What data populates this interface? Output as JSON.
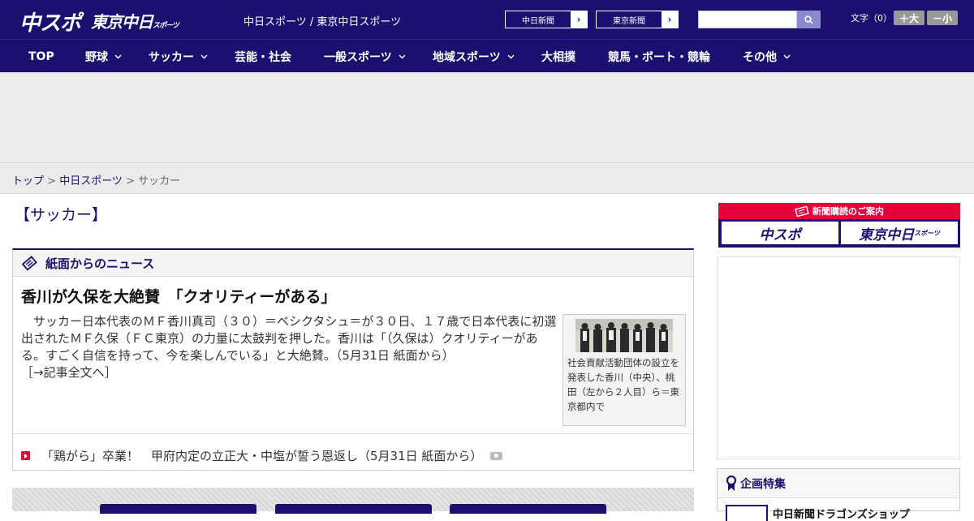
{
  "header": {
    "logo_chuspo": "中スポ",
    "logo_tokyo": "東京中日",
    "logo_tokyo_suffix": "スポーツ",
    "site_title": "中日スポーツ / 東京中日スポーツ",
    "paper_links": [
      {
        "label": "中日新聞"
      },
      {
        "label": "東京新聞"
      }
    ],
    "search_placeholder": "",
    "font_size_label": "文字（0）",
    "font_bigger": "＋大",
    "font_smaller": "－小"
  },
  "nav": {
    "items": [
      {
        "label": "TOP",
        "has_menu": false
      },
      {
        "label": "野球",
        "has_menu": true
      },
      {
        "label": "サッカー",
        "has_menu": true
      },
      {
        "label": "芸能・社会",
        "has_menu": false
      },
      {
        "label": "一般スポーツ",
        "has_menu": true
      },
      {
        "label": "地域スポーツ",
        "has_menu": true
      },
      {
        "label": "大相撲",
        "has_menu": false
      },
      {
        "label": "競馬・ボート・競輪",
        "has_menu": false
      },
      {
        "label": "その他",
        "has_menu": true
      }
    ]
  },
  "breadcrumb": {
    "top": "トップ",
    "sep1": " > ",
    "mid": "中日スポーツ",
    "sep2": " > ",
    "current": "サッカー"
  },
  "main": {
    "section_title": "【サッカー】",
    "news_box": {
      "header_label": "紙面からのニュース",
      "headline": "香川が久保を大絶賛　「クオリティーがある」",
      "body": "　サッカー日本代表のＭＦ香川真司（３０）＝ベシクタシュ＝が３０日、１７歳で日本代表に初選出されたＭＦ久保（ＦＣ東京）の力量に太鼓判を押した。香川は「（久保は）クオリティーがある。すごく自信を持って、今を楽しんでいる」と大絶賛。（5月31日 紙面から）",
      "read_more": "［→記事全文へ］",
      "photo_caption": "社会貢献活動団体の設立を発表した香川（中央）、桃田（左から２人目）ら＝東京都内で",
      "sub_news": "「鶏がら」卒業！　甲府内定の立正大・中塩が誓う恩返し（5月31日 紙面から）"
    }
  },
  "sidebar": {
    "subscribe_label": "新聞購読のご案内",
    "logo_chuspo": "中スポ",
    "logo_tokyo": "東京中日",
    "logo_tokyo_suffix": "スポーツ",
    "kikaku_title": "企画特集",
    "kikaku_item": "中日新聞ドラゴンズショップ"
  },
  "colors": {
    "brand_navy": "#1b1070",
    "accent_red": "#e6003a",
    "bullet_red": "#d31433"
  }
}
